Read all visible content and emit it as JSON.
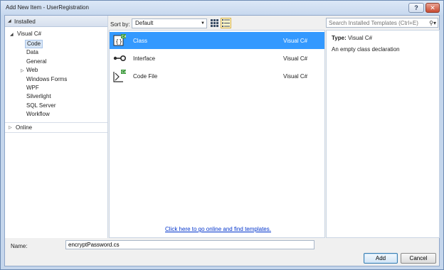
{
  "window": {
    "title": "Add New Item - UserRegistration",
    "help_label": "?",
    "close_label": "✕"
  },
  "left": {
    "installed_label": "Installed",
    "tree": [
      {
        "label": "Visual C#",
        "expanded": true
      },
      {
        "label": "Code",
        "selected": true
      },
      {
        "label": "Data"
      },
      {
        "label": "General"
      },
      {
        "label": "Web",
        "collapsed": true
      },
      {
        "label": "Windows Forms"
      },
      {
        "label": "WPF"
      },
      {
        "label": "Silverlight"
      },
      {
        "label": "SQL Server"
      },
      {
        "label": "Workflow"
      }
    ],
    "online_label": "Online"
  },
  "toolbar": {
    "sort_label": "Sort by:",
    "sort_value": "Default",
    "search_placeholder": "Search Installed Templates (Ctrl+E)"
  },
  "templates": [
    {
      "name": "Class",
      "lang": "Visual C#",
      "selected": true,
      "icon": "class-icon"
    },
    {
      "name": "Interface",
      "lang": "Visual C#",
      "icon": "interface-icon"
    },
    {
      "name": "Code File",
      "lang": "Visual C#",
      "icon": "code-file-icon"
    }
  ],
  "online_link": "Click here to go online and find templates.",
  "details": {
    "type_label": "Type:",
    "type_value": "Visual C#",
    "description": "An empty class declaration"
  },
  "bottom": {
    "name_label": "Name:",
    "name_value": "encryptPassword.cs",
    "add_label": "Add",
    "cancel_label": "Cancel"
  },
  "colors": {
    "selection": "#3399ff",
    "link": "#0033cc",
    "tree_selection": "#d8e6f6"
  }
}
